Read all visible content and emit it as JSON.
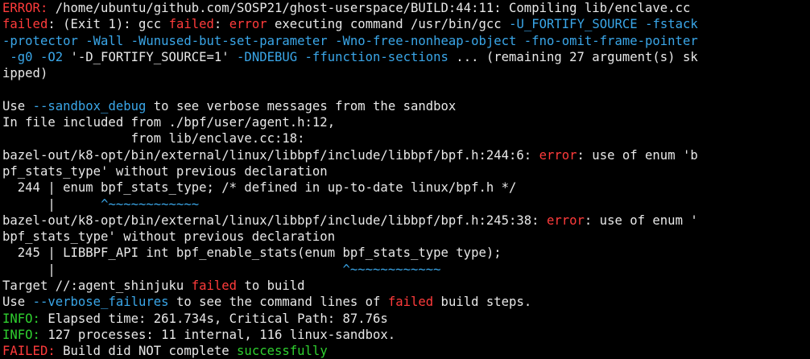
{
  "colors": {
    "background": "#000000",
    "foreground": "#e8e8e8",
    "error_red": "#ff3b3b",
    "option_cyan": "#3aa6e8",
    "info_green": "#2fd02f"
  },
  "lines": [
    [
      {
        "t": "ERROR:",
        "c": "red"
      },
      {
        "t": " /home/ubuntu/github.com/SOSP21/ghost-userspace/BUILD:44:11: Compiling lib/enclave.cc",
        "c": "white"
      }
    ],
    [
      {
        "t": "failed",
        "c": "red"
      },
      {
        "t": ": (Exit 1): gcc ",
        "c": "white"
      },
      {
        "t": "failed",
        "c": "red"
      },
      {
        "t": ": ",
        "c": "white"
      },
      {
        "t": "error",
        "c": "red"
      },
      {
        "t": " executing command /usr/bin/gcc ",
        "c": "white"
      },
      {
        "t": "-U_FORTIFY_SOURCE -fstack",
        "c": "cyan"
      }
    ],
    [
      {
        "t": "-protector -Wall -Wunused-but-set-parameter -Wno-free-nonheap-object -fno-omit-frame-pointer",
        "c": "cyan"
      }
    ],
    [
      {
        "t": " -g0 -O2 ",
        "c": "cyan"
      },
      {
        "t": "'-D_FORTIFY_SOURCE=1'",
        "c": "white"
      },
      {
        "t": " -DNDEBUG -ffunction-sections",
        "c": "cyan"
      },
      {
        "t": " ... (remaining 27 argument(s) sk",
        "c": "white"
      }
    ],
    [
      {
        "t": "ipped)",
        "c": "white"
      }
    ],
    [
      {
        "t": "",
        "c": "white"
      }
    ],
    [
      {
        "t": "Use ",
        "c": "white"
      },
      {
        "t": "--sandbox_debug",
        "c": "cyan"
      },
      {
        "t": " to see verbose messages from the sandbox",
        "c": "white"
      }
    ],
    [
      {
        "t": "In file included from ./bpf/user/agent.h:12,",
        "c": "white"
      }
    ],
    [
      {
        "t": "                 from lib/enclave.cc:18:",
        "c": "white"
      }
    ],
    [
      {
        "t": "bazel-out/k8-opt/bin/external/linux/libbpf/include/libbpf/bpf.h:244:6: ",
        "c": "white"
      },
      {
        "t": "error",
        "c": "red"
      },
      {
        "t": ": use of enum 'b",
        "c": "white"
      }
    ],
    [
      {
        "t": "pf_stats_type' without previous declaration",
        "c": "white"
      }
    ],
    [
      {
        "t": "  244 | enum bpf_stats_type; /* defined in up-to-date linux/bpf.h */",
        "c": "white"
      }
    ],
    [
      {
        "t": "      |      ",
        "c": "white"
      },
      {
        "t": "^~~~~~~~~~~~~",
        "c": "cyan"
      }
    ],
    [
      {
        "t": "bazel-out/k8-opt/bin/external/linux/libbpf/include/libbpf/bpf.h:245:38: ",
        "c": "white"
      },
      {
        "t": "error",
        "c": "red"
      },
      {
        "t": ": use of enum '",
        "c": "white"
      }
    ],
    [
      {
        "t": "bpf_stats_type' without previous declaration",
        "c": "white"
      }
    ],
    [
      {
        "t": "  245 | LIBBPF_API int bpf_enable_stats(enum bpf_stats_type type);",
        "c": "white"
      }
    ],
    [
      {
        "t": "      |                                      ",
        "c": "white"
      },
      {
        "t": "^~~~~~~~~~~~~",
        "c": "cyan"
      }
    ],
    [
      {
        "t": "Target //:agent_shinjuku ",
        "c": "white"
      },
      {
        "t": "failed",
        "c": "red"
      },
      {
        "t": " to build",
        "c": "white"
      }
    ],
    [
      {
        "t": "Use ",
        "c": "white"
      },
      {
        "t": "--verbose_failures",
        "c": "cyan"
      },
      {
        "t": " to see the command lines of ",
        "c": "white"
      },
      {
        "t": "failed",
        "c": "red"
      },
      {
        "t": " build steps.",
        "c": "white"
      }
    ],
    [
      {
        "t": "INFO:",
        "c": "green"
      },
      {
        "t": " Elapsed time: 261.734s, Critical Path: 87.76s",
        "c": "white"
      }
    ],
    [
      {
        "t": "INFO:",
        "c": "green"
      },
      {
        "t": " 127 processes: 11 internal, 116 linux-sandbox.",
        "c": "white"
      }
    ],
    [
      {
        "t": "FAILED:",
        "c": "red"
      },
      {
        "t": " Build did NOT complete ",
        "c": "white"
      },
      {
        "t": "successfully",
        "c": "green"
      }
    ]
  ]
}
